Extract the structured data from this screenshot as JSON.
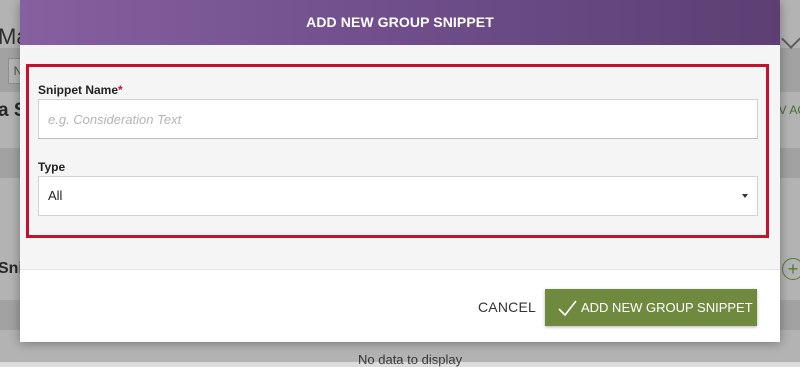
{
  "background": {
    "title": "Ma",
    "tab_label": "N",
    "heading_1": "a S",
    "heading_2": "Sni",
    "right_link": "V AC",
    "empty_message": "No data to display"
  },
  "modal": {
    "title": "ADD NEW GROUP SNIPPET",
    "fields": {
      "snippet_name": {
        "label": "Snippet Name",
        "required_mark": "*",
        "placeholder": "e.g. Consideration Text",
        "value": ""
      },
      "type": {
        "label": "Type",
        "selected": "All"
      }
    },
    "footer": {
      "cancel_label": "CANCEL",
      "submit_label": "ADD NEW GROUP SNIPPET"
    }
  },
  "colors": {
    "header_gradient_start": "#86609f",
    "header_gradient_end": "#5d3f73",
    "highlight": "#c8102e",
    "primary_button": "#6f8a3f"
  }
}
